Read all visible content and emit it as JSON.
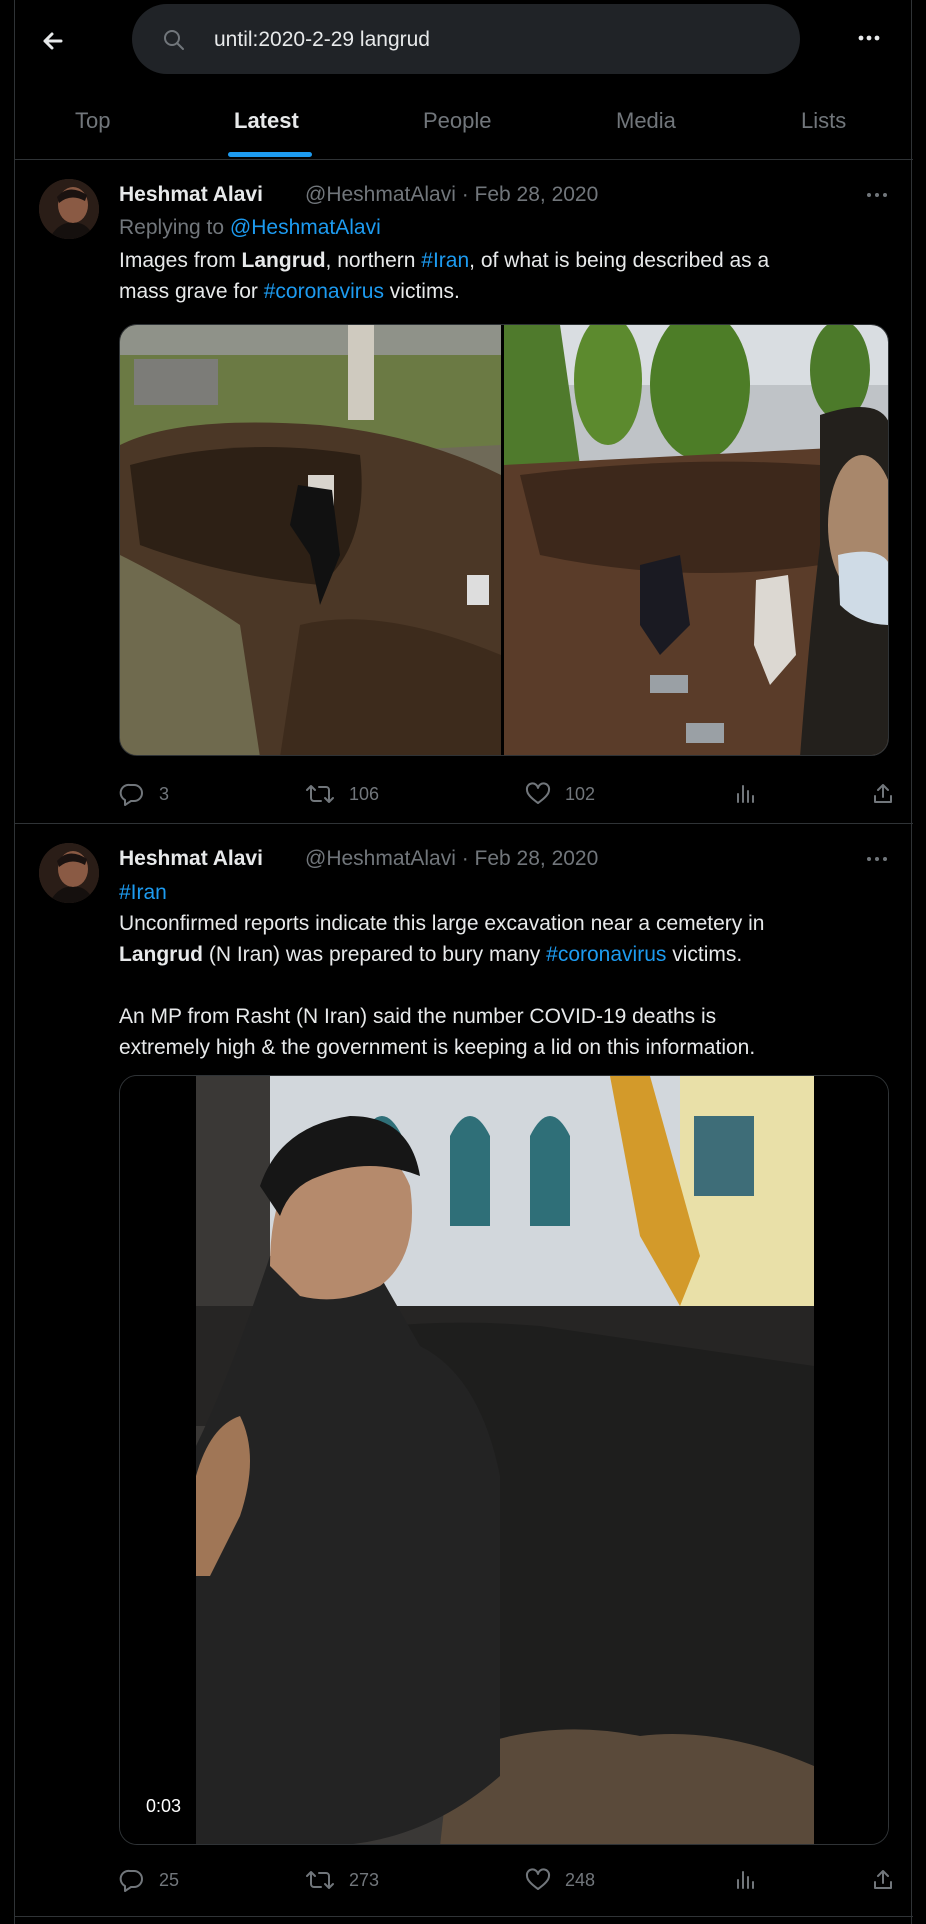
{
  "search": {
    "query": "until:2020-2-29 langrud"
  },
  "tabs": [
    {
      "label": "Top"
    },
    {
      "label": "Latest"
    },
    {
      "label": "People"
    },
    {
      "label": "Media"
    },
    {
      "label": "Lists"
    }
  ],
  "active_tab": "Latest",
  "icons": {
    "back": "arrow-left-icon",
    "search": "search-icon",
    "more": "more-icon",
    "reply": "reply-icon",
    "retweet": "retweet-icon",
    "like": "heart-icon",
    "views": "analytics-icon",
    "share": "share-icon"
  },
  "colors": {
    "accent": "#1d9bf0",
    "muted": "#71767b",
    "text": "#e7e9ea",
    "border": "#2f3336",
    "background": "#000000"
  },
  "tweets": [
    {
      "name": "Heshmat Alavi",
      "meta": "@HeshmatAlavi · Feb 28, 2020",
      "replying_prefix": "Replying to ",
      "replying_handle": "@HeshmatAlavi",
      "text": {
        "t1": "Images from ",
        "b1": "Langrud",
        "t2": ", northern ",
        "l1": "#Iran",
        "t3": ", of what is being described as a",
        "t4": "mass grave for ",
        "l2": "#coronavirus",
        "t5": " victims."
      },
      "replies": "3",
      "retweets": "106",
      "likes": "102"
    },
    {
      "name": "Heshmat Alavi",
      "meta": "@HeshmatAlavi · Feb 28, 2020",
      "text": {
        "l0": "#Iran",
        "t1": "Unconfirmed reports indicate this large excavation near a cemetery in",
        "b1": "Langrud",
        "t2": " (N Iran) was prepared to bury many ",
        "l1": "#coronavirus",
        "t3": " victims.",
        "p2a": "An MP from Rasht (N Iran) said the number COVID-19 deaths is",
        "p2b": "extremely high & the government is keeping a lid on this information."
      },
      "video_duration": "0:03",
      "replies": "25",
      "retweets": "273",
      "likes": "248"
    }
  ]
}
